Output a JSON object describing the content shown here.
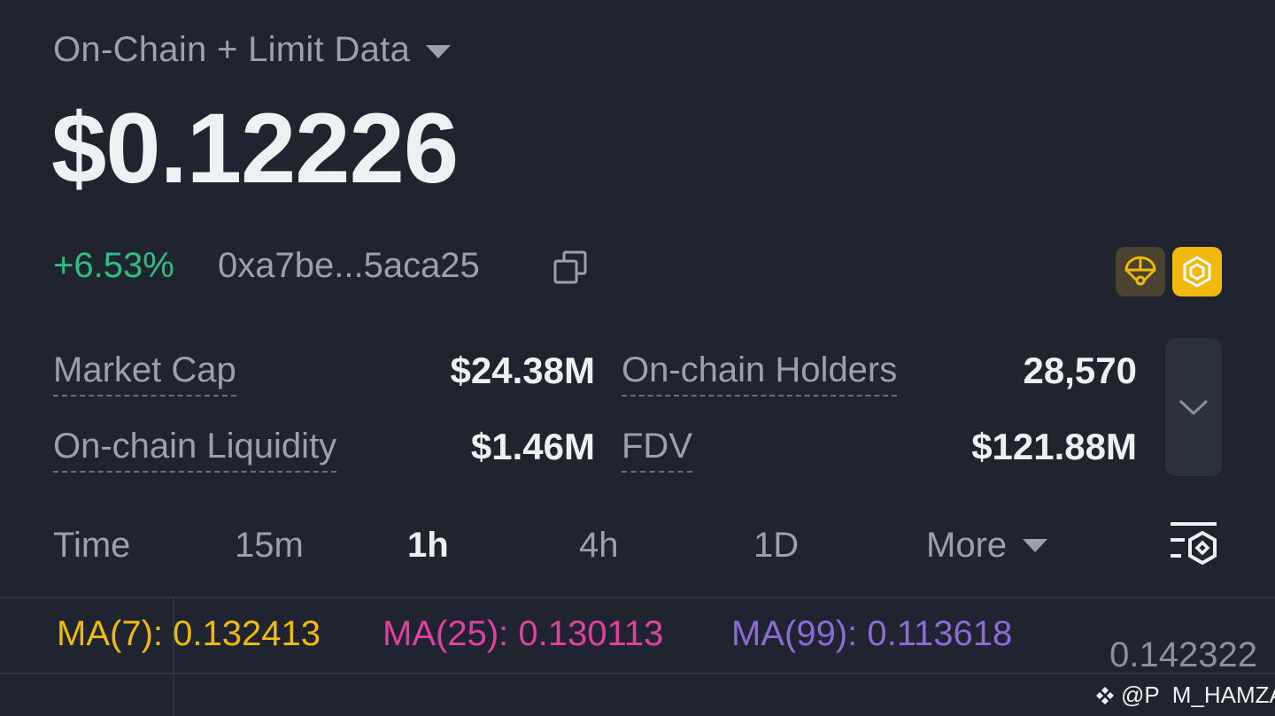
{
  "header": {
    "source_label": "On-Chain + Limit Data"
  },
  "token": {
    "price": "$0.12226",
    "change": "+6.53%",
    "address": "0xa7be...5aca25"
  },
  "stats": {
    "market_cap_label": "Market Cap",
    "market_cap_value": "$24.38M",
    "holders_label": "On-chain Holders",
    "holders_value": "28,570",
    "liquidity_label": "On-chain Liquidity",
    "liquidity_value": "$1.46M",
    "fdv_label": "FDV",
    "fdv_value": "$121.88M"
  },
  "timeframes": {
    "time_label": "Time",
    "items": [
      "15m",
      "1h",
      "4h",
      "1D"
    ],
    "active": "1h",
    "more_label": "More"
  },
  "indicators": {
    "ma7": "MA(7): 0.132413",
    "ma25": "MA(25): 0.130113",
    "ma99": "MA(99): 0.113618",
    "ma7_color": "#f0b90b",
    "ma25_color": "#e040a0",
    "ma99_color": "#8e6ad6"
  },
  "chart": {
    "axis_price_top": "0.142322"
  },
  "watermark": {
    "text": "@P  M_HAMZA"
  },
  "colors": {
    "background": "#1f2430",
    "positive": "#2ebd85",
    "bnb": "#f0b90b"
  },
  "icons": [
    "chevron-down-icon",
    "copy-icon",
    "parachute-icon",
    "bnb-chain-icon",
    "chart-settings-icon",
    "binance-logo-icon"
  ]
}
